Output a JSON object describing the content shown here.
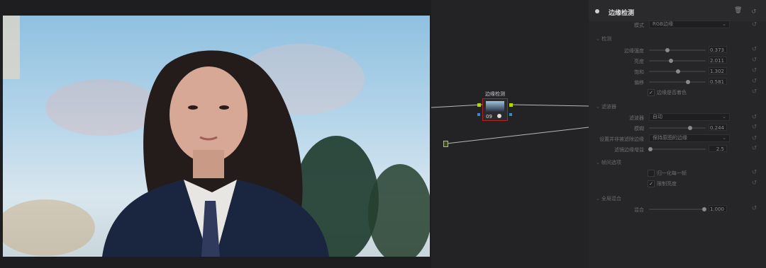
{
  "inspector": {
    "title": "边缘检测",
    "mode": {
      "label": "模式",
      "value": "RGB边缘"
    },
    "sections": {
      "detect": "检测",
      "filter": "滤波器",
      "frame": "帧间选项",
      "global": "全局混合"
    },
    "params": [
      {
        "label": "边缘强度",
        "value": "0.373",
        "level": 0.373
      },
      {
        "label": "亮度",
        "value": "2.011",
        "level": 0.4
      },
      {
        "label": "饱和",
        "value": "1.302",
        "level": 0.6
      },
      {
        "label": "偏移",
        "value": "0.581",
        "level": 0.78
      }
    ],
    "checkbox_color_edge": {
      "label": "边缘是否着色",
      "checked": true
    },
    "filter": {
      "filter_type": {
        "label": "滤波器",
        "value": "自动"
      },
      "smooth": {
        "label": "模糊",
        "value": "0.244",
        "level": 0.8
      },
      "edge_mode": {
        "label": "设置并非被滤除边缘",
        "value": "保持原图的边缘"
      },
      "blur_size": {
        "label": "滤镜边缘增益",
        "value": "2.5",
        "level": 0.02
      }
    },
    "frame_opts": [
      {
        "label": "归一化每一帧",
        "checked": false
      },
      {
        "label": "限制亮度",
        "checked": true
      }
    ],
    "global": {
      "label": "混合",
      "value": "1.000",
      "level": 1.0
    }
  },
  "node": {
    "title": "边缘检测",
    "number": "09"
  },
  "colors": {
    "accent_green": "#b6d400",
    "node_border": "#b32222",
    "port_blue": "#2a8fd6"
  }
}
